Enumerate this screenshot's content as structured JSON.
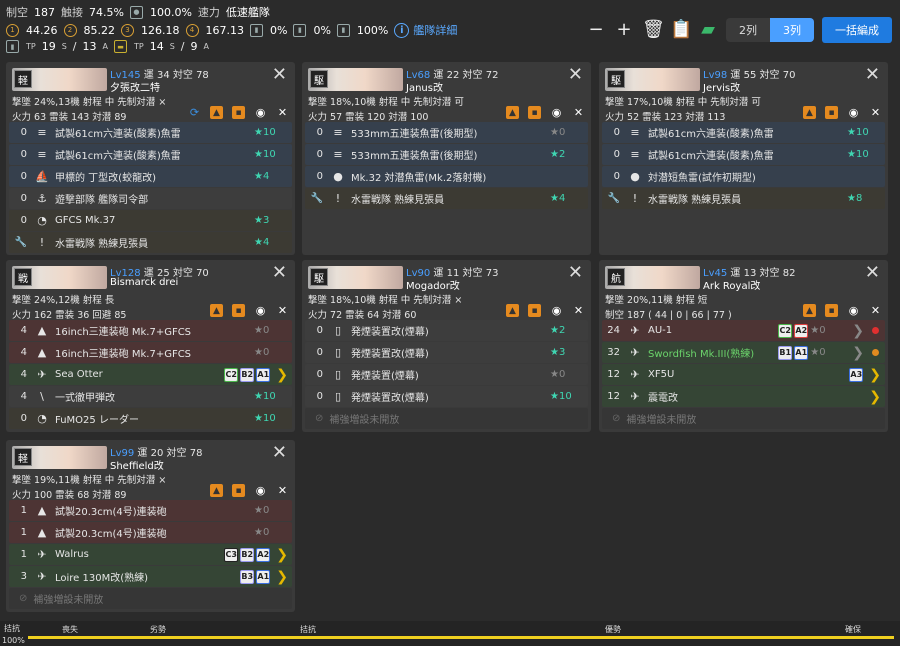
{
  "header": {
    "r1": {
      "seiku_l": "制空",
      "seiku": "187",
      "sesshoku_l": "触接",
      "sesshoku": "74.5%",
      "ctr": "100.0%",
      "speed_l": "速力",
      "speed": "低速艦隊"
    },
    "r2": {
      "v1": "44.26",
      "v2": "85.22",
      "v3": "126.18",
      "v4": "167.13",
      "p1": "0%",
      "p2": "0%",
      "p3": "100%",
      "info": "艦隊詳細"
    },
    "r3": {
      "tp1": "19",
      "tp1s": "S",
      "tp2": "13",
      "tp2s": "A",
      "tp3": "14",
      "tp3s": "S",
      "tp4": "9",
      "tp4s": "A"
    },
    "cols": [
      "2列",
      "3列"
    ],
    "bulk": "一括編成"
  },
  "ships": [
    {
      "lv": "Lv145",
      "luck": "34",
      "aa": "78",
      "name": "夕張改二特",
      "type": "軽",
      "s1": "撃墜 24%,13機 射程 中 先制対潜 ×",
      "s2": "火力 63 雷装 143 対潜 89",
      "sync": true,
      "eq": [
        [
          "torp",
          "≡",
          "0",
          "試製61cm六連装(酸素)魚雷",
          "★10",
          "hi"
        ],
        [
          "torp",
          "≡",
          "0",
          "試製61cm六連装(酸素)魚雷",
          "★10",
          "hi"
        ],
        [
          "torp",
          "⛵",
          "0",
          "甲標的 丁型改(蛟龍改)",
          "★4",
          "hi"
        ],
        [
          "misc",
          "⚓",
          "0",
          "遊撃部隊 艦隊司令部",
          "",
          ""
        ],
        [
          "ex",
          "◔",
          "0",
          "GFCS Mk.37",
          "★3",
          "hi"
        ],
        [
          "ex2",
          "!",
          "",
          "水雷戦隊 熟練見張員",
          "★4",
          "hi"
        ]
      ]
    },
    {
      "lv": "Lv68",
      "luck": "22",
      "aa": "72",
      "name": "Janus改",
      "type": "駆",
      "s1": "撃墜 18%,10機 射程 中 先制対潜 可",
      "s2": "火力 57 雷装 120 対潜 100",
      "eq": [
        [
          "torp",
          "≡",
          "0",
          "533mm五連装魚雷(後期型)",
          "★0",
          "lo"
        ],
        [
          "torp",
          "≡",
          "0",
          "533mm五連装魚雷(後期型)",
          "★2",
          "hi"
        ],
        [
          "torp",
          "●",
          "0",
          "Mk.32 対潜魚雷(Mk.2落射機)",
          "",
          ""
        ],
        [
          "ex2",
          "!",
          "",
          "水雷戦隊 熟練見張員",
          "★4",
          "hi"
        ]
      ]
    },
    {
      "lv": "Lv98",
      "luck": "55",
      "aa": "70",
      "name": "Jervis改",
      "type": "駆",
      "s1": "撃墜 17%,10機 射程 中 先制対潜 可",
      "s2": "火力 52 雷装 123 対潜 113",
      "eq": [
        [
          "torp",
          "≡",
          "0",
          "試製61cm六連装(酸素)魚雷",
          "★10",
          "hi"
        ],
        [
          "torp",
          "≡",
          "0",
          "試製61cm六連装(酸素)魚雷",
          "★10",
          "hi"
        ],
        [
          "torp",
          "●",
          "0",
          "対潜短魚雷(試作初期型)",
          "",
          ""
        ],
        [
          "ex2",
          "!",
          "",
          "水雷戦隊 熟練見張員",
          "★8",
          "hi"
        ]
      ]
    },
    {
      "lv": "Lv128",
      "luck": "25",
      "aa": "70",
      "name": "Bismarck drei",
      "type": "戦",
      "s1": "撃墜 24%,12機 射程 長",
      "s2": "火力 162 雷装 36 回避 85",
      "eq": [
        [
          "gun",
          "▲",
          "4",
          "16inch三連装砲 Mk.7+GFCS",
          "★0",
          "lo"
        ],
        [
          "gun",
          "▲",
          "4",
          "16inch三連装砲 Mk.7+GFCS",
          "★0",
          "lo"
        ],
        [
          "air",
          "✈",
          "4",
          "Sea Otter",
          "",
          "",
          "C2,B2,A1",
          "y"
        ],
        [
          "misc",
          "\\",
          "4",
          "一式徹甲弾改",
          "★10",
          "hi"
        ],
        [
          "ex",
          "◔",
          "0",
          "FuMO25 レーダー",
          "★10",
          "hi"
        ]
      ]
    },
    {
      "lv": "Lv90",
      "luck": "11",
      "aa": "73",
      "name": "Mogador改",
      "type": "駆",
      "s1": "撃墜 18%,10機 射程 中 先制対潜 ×",
      "s2": "火力 72 雷装 64 対潜 60",
      "eq": [
        [
          "misc",
          "▯",
          "0",
          "発煙装置改(煙幕)",
          "★2",
          "hi"
        ],
        [
          "misc",
          "▯",
          "0",
          "発煙装置改(煙幕)",
          "★3",
          "hi"
        ],
        [
          "misc",
          "▯",
          "0",
          "発煙装置(煙幕)",
          "★0",
          "lo"
        ],
        [
          "misc",
          "▯",
          "0",
          "発煙装置改(煙幕)",
          "★10",
          "hi"
        ],
        [
          "empty",
          "⊘",
          "",
          "補強増設未開放",
          "",
          ""
        ]
      ]
    },
    {
      "lv": "Lv45",
      "luck": "13",
      "aa": "82",
      "name": "Ark Royal改",
      "type": "航",
      "s1": "撃墜 20%,11機 射程 短",
      "s2": "制空 187 ( 44 | 0 | 66 | 77 )",
      "eq": [
        [
          "gun",
          "✈",
          "24",
          "AU-1",
          "★0",
          "lo",
          "C2,A2r",
          "g",
          "#e03030"
        ],
        [
          "air",
          "✈",
          "32",
          "Swordfish Mk.III(熟練)",
          "★0",
          "lo",
          "B1,A1",
          "g",
          "#e08a20"
        ],
        [
          "air",
          "✈",
          "12",
          "XF5U",
          "",
          "",
          "A3",
          "y"
        ],
        [
          "air",
          "✈",
          "12",
          "震電改",
          "",
          "",
          "",
          "y"
        ],
        [
          "empty",
          "⊘",
          "",
          "補強増設未開放",
          "",
          ""
        ]
      ]
    },
    {
      "lv": "Lv99",
      "luck": "20",
      "aa": "78",
      "name": "Sheffield改",
      "type": "軽",
      "s1": "撃墜 19%,11機 射程 中 先制対潜 ×",
      "s2": "火力 100 雷装 68 対潜 89",
      "eq": [
        [
          "gun",
          "▲",
          "1",
          "試製20.3cm(4号)連装砲",
          "★0",
          "lo"
        ],
        [
          "gun",
          "▲",
          "1",
          "試製20.3cm(4号)連装砲",
          "★0",
          "lo"
        ],
        [
          "air",
          "✈",
          "1",
          "Walrus",
          "",
          "",
          "C3,B2,A2",
          "y"
        ],
        [
          "air",
          "✈",
          "3",
          "Loire 130M改(熟練)",
          "",
          "",
          "B3,A1",
          "y"
        ],
        [
          "empty",
          "⊘",
          "",
          "補強増設未開放",
          "",
          ""
        ]
      ]
    }
  ],
  "labels": {
    "lv_luck": "運",
    "lv_aa": "対空"
  },
  "bottom": {
    "l0": "拮抗",
    "p": "100%",
    "c1": "喪失",
    "c2": "劣勢",
    "c3": "拮抗",
    "c4": "優勢",
    "c5": "確保"
  }
}
